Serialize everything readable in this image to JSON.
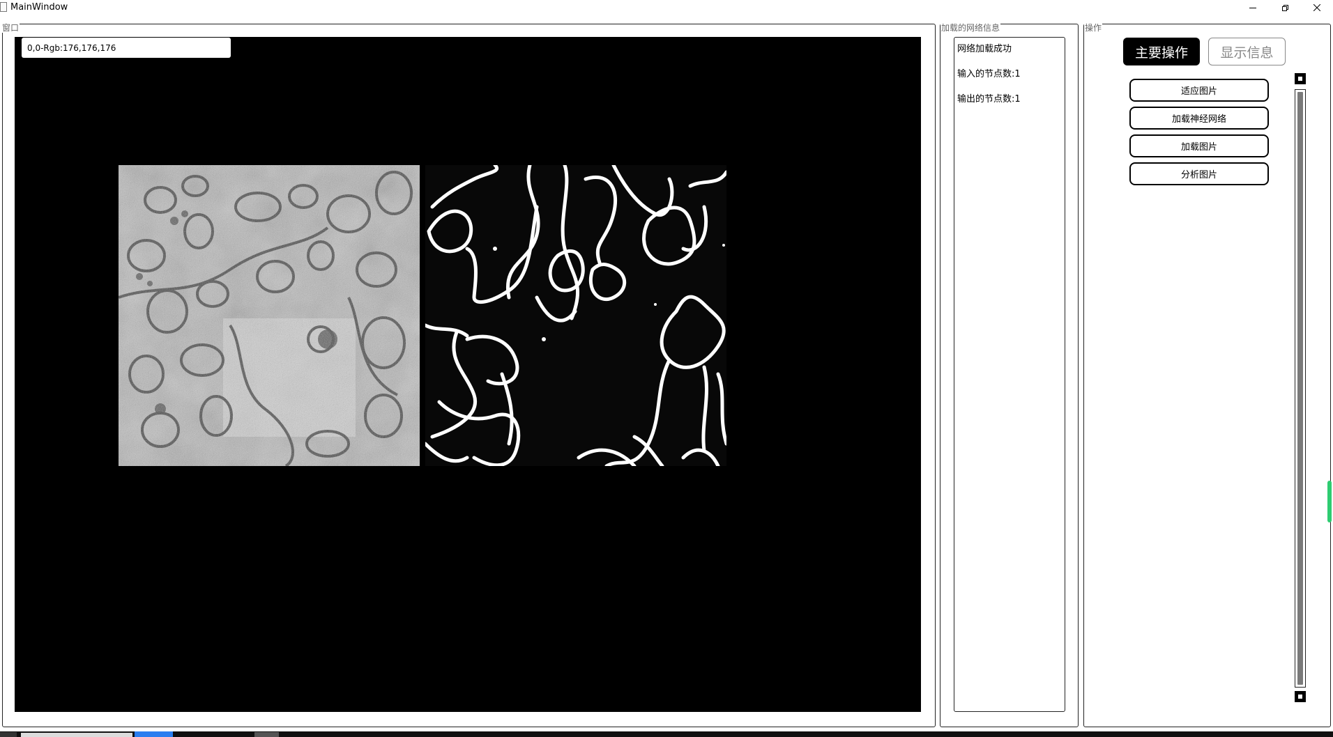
{
  "window": {
    "title": "MainWindow"
  },
  "canvas": {
    "group_title": "窗口",
    "pixel_readout": "0,0-Rgb:176,176,176"
  },
  "network_info": {
    "group_title": "加载的网络信息",
    "lines": [
      "网络加载成功",
      "输入的节点数:1",
      "输出的节点数:1"
    ]
  },
  "operations": {
    "group_title": "操作",
    "tabs": [
      {
        "label": "主要操作",
        "active": true
      },
      {
        "label": "显示信息",
        "active": false
      }
    ],
    "buttons": [
      "适应图片",
      "加载神经网络",
      "加载图片",
      "分析图片"
    ]
  },
  "icons": {
    "app": "app-icon",
    "minimize": "minimize-icon",
    "restore": "restore-icon",
    "close": "close-icon",
    "scroll_up": "scroll-up-icon",
    "scroll_down": "scroll-down-icon"
  },
  "colors": {
    "canvas_background": "#000000",
    "active_tab": "#000000",
    "inactive_tab_text": "#888888",
    "scroll_thumb": "#7a7a7a",
    "resize_handle": "#2ecc71",
    "taskbar_accent": "#2a7ef0"
  }
}
